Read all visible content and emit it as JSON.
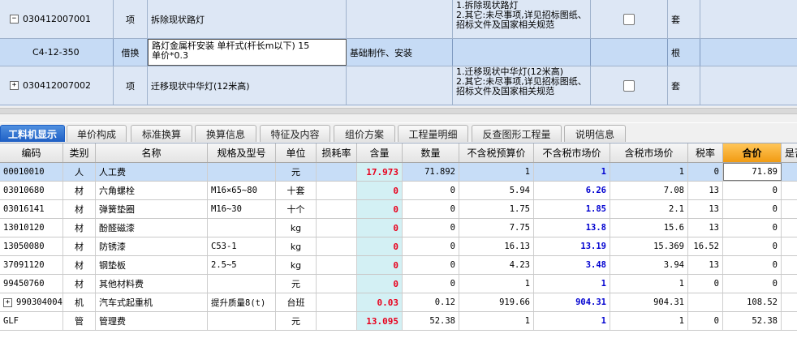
{
  "top_rows": [
    {
      "code": "030412007001",
      "expander": "−",
      "type": "项",
      "name": "拆除现状路灯",
      "spec": "",
      "features": "1.拆除现状路灯\n2.其它:未尽事项,详见招标图纸、招标文件及国家相关规范",
      "unit": "套"
    },
    {
      "code": "C4-12-350",
      "type": "借换",
      "name": "路灯金属杆安装 单杆式(杆长m以下) 15\n单价*0.3",
      "spec": "基础制作、安装",
      "features": "",
      "unit": "根"
    },
    {
      "code": "030412007002",
      "expander": "+",
      "type": "项",
      "name": "迁移现状中华灯(12米高)",
      "spec": "",
      "features": "1.迁移现状中华灯(12米高)\n2.其它:未尽事项,详见招标图纸、招标文件及国家相关规范",
      "unit": "套"
    }
  ],
  "tabs": [
    "工料机显示",
    "单价构成",
    "标准换算",
    "换算信息",
    "特征及内容",
    "组价方案",
    "工程量明细",
    "反查图形工程量",
    "说明信息"
  ],
  "active_tab": 0,
  "columns": [
    "编码",
    "类别",
    "名称",
    "规格及型号",
    "单位",
    "损耗率",
    "含量",
    "数量",
    "不含税预算价",
    "不含税市场价",
    "含税市场价",
    "税率",
    "合价",
    "是否"
  ],
  "rows": [
    {
      "code": "00010010",
      "cat": "人",
      "name": "人工费",
      "spec": "",
      "unit": "元",
      "loss": "",
      "qty": "17.973",
      "num": "71.892",
      "budget": "1",
      "market": "1",
      "taxmarket": "1",
      "rate": "0",
      "total": "71.89",
      "expander": ""
    },
    {
      "code": "03010680",
      "cat": "材",
      "name": "六角螺栓",
      "spec": "M16×65~80",
      "unit": "十套",
      "loss": "",
      "qty": "0",
      "num": "0",
      "budget": "5.94",
      "market": "6.26",
      "taxmarket": "7.08",
      "rate": "13",
      "total": "0",
      "expander": ""
    },
    {
      "code": "03016141",
      "cat": "材",
      "name": "弹簧垫圈",
      "spec": "M16~30",
      "unit": "十个",
      "loss": "",
      "qty": "0",
      "num": "0",
      "budget": "1.75",
      "market": "1.85",
      "taxmarket": "2.1",
      "rate": "13",
      "total": "0",
      "expander": ""
    },
    {
      "code": "13010120",
      "cat": "材",
      "name": "酚醛磁漆",
      "spec": "",
      "unit": "kg",
      "loss": "",
      "qty": "0",
      "num": "0",
      "budget": "7.75",
      "market": "13.8",
      "taxmarket": "15.6",
      "rate": "13",
      "total": "0",
      "expander": ""
    },
    {
      "code": "13050080",
      "cat": "材",
      "name": "防锈漆",
      "spec": "C53-1",
      "unit": "kg",
      "loss": "",
      "qty": "0",
      "num": "0",
      "budget": "16.13",
      "market": "13.19",
      "taxmarket": "15.369",
      "rate": "16.52",
      "total": "0",
      "expander": ""
    },
    {
      "code": "37091120",
      "cat": "材",
      "name": "钢垫板",
      "spec": "2.5~5",
      "unit": "kg",
      "loss": "",
      "qty": "0",
      "num": "0",
      "budget": "4.23",
      "market": "3.48",
      "taxmarket": "3.94",
      "rate": "13",
      "total": "0",
      "expander": ""
    },
    {
      "code": "99450760",
      "cat": "材",
      "name": "其他材料费",
      "spec": "",
      "unit": "元",
      "loss": "",
      "qty": "0",
      "num": "0",
      "budget": "1",
      "market": "1",
      "taxmarket": "1",
      "rate": "0",
      "total": "0",
      "expander": ""
    },
    {
      "code": "990304004",
      "cat": "机",
      "name": "汽车式起重机",
      "spec": "提升质量8(t)",
      "unit": "台班",
      "loss": "",
      "qty": "0.03",
      "num": "0.12",
      "budget": "919.66",
      "market": "904.31",
      "taxmarket": "904.31",
      "rate": "",
      "total": "108.52",
      "expander": "+"
    },
    {
      "code": "GLF",
      "cat": "管",
      "name": "管理费",
      "spec": "",
      "unit": "元",
      "loss": "",
      "qty": "13.095",
      "num": "52.38",
      "budget": "1",
      "market": "1",
      "taxmarket": "1",
      "rate": "0",
      "total": "52.38",
      "expander": ""
    }
  ],
  "colors": {
    "accent": "#1e5fc4",
    "qty_bg": "#d3f0f4",
    "qty_text": "#e8001c",
    "market_text": "#0000d0",
    "selected_row": "#c7ddf7",
    "total_header": "#f19b12"
  },
  "icons": [
    "collapse-icon",
    "expand-icon",
    "checkbox"
  ]
}
